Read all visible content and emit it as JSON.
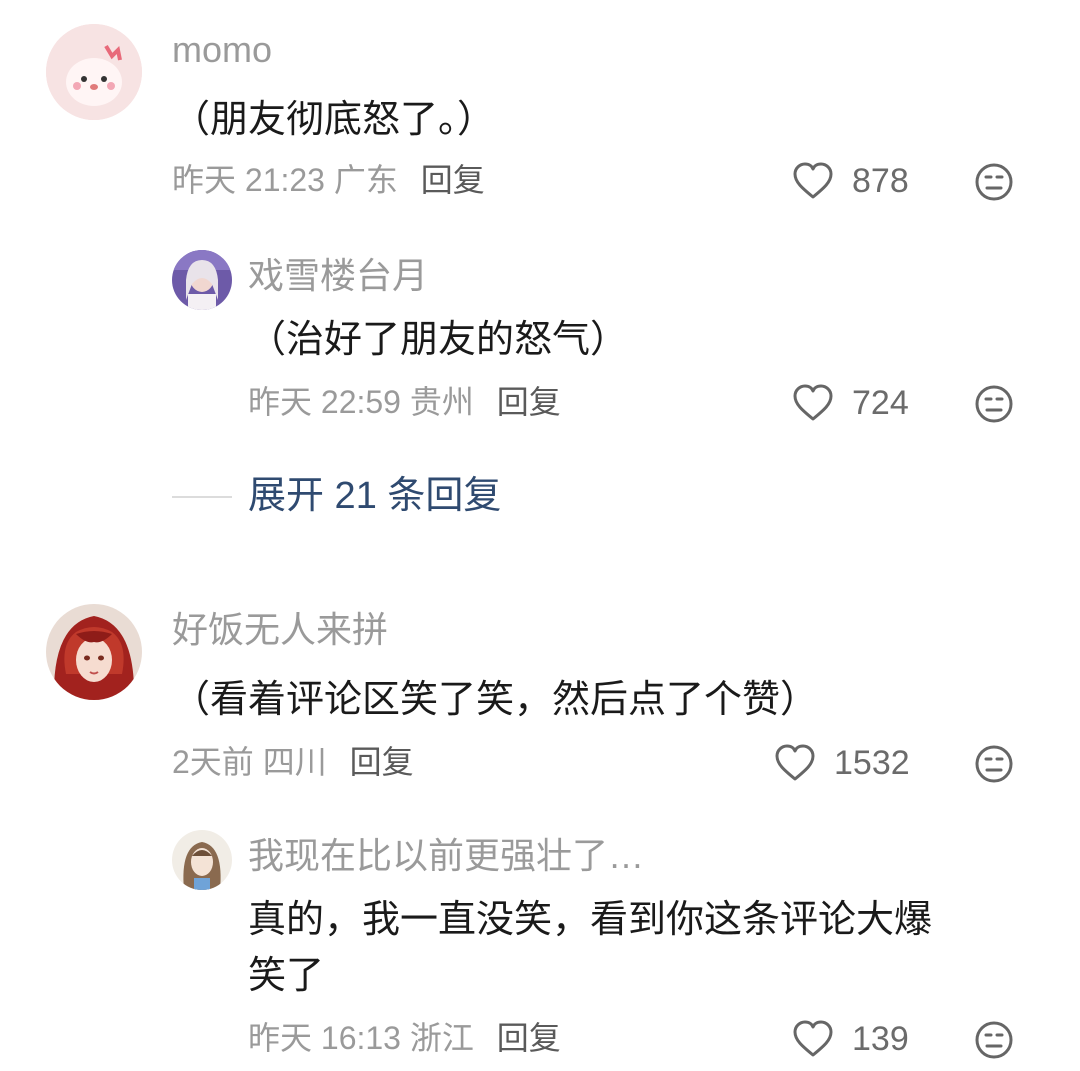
{
  "comments": [
    {
      "user": "momo",
      "text": "（朋友彻底怒了。）",
      "time": "昨天 21:23",
      "location": "广东",
      "reply_label": "回复",
      "likes": "878",
      "replies": [
        {
          "user": "戏雪楼台月",
          "text": "（治好了朋友的怒气）",
          "time": "昨天 22:59",
          "location": "贵州",
          "reply_label": "回复",
          "likes": "724"
        }
      ],
      "expand_label": "展开 21 条回复"
    },
    {
      "user": "好饭无人来拼",
      "text": "（看着评论区笑了笑，然后点了个赞）",
      "time": "2天前",
      "location": "四川",
      "reply_label": "回复",
      "likes": "1532",
      "replies": [
        {
          "user": "我现在比以前更强壮了…",
          "text_line1": "真的，我一直没笑，看到你这条评论大爆",
          "text_line2": "笑了",
          "time": "昨天 16:13",
          "location": "浙江",
          "reply_label": "回复",
          "likes": "139"
        }
      ]
    }
  ],
  "icons": {
    "like": "heart-outline-icon",
    "dislike": "meh-face-icon"
  },
  "colors": {
    "username": "#9a9a9a",
    "text": "#1a1a1a",
    "link": "#2f4a70"
  }
}
